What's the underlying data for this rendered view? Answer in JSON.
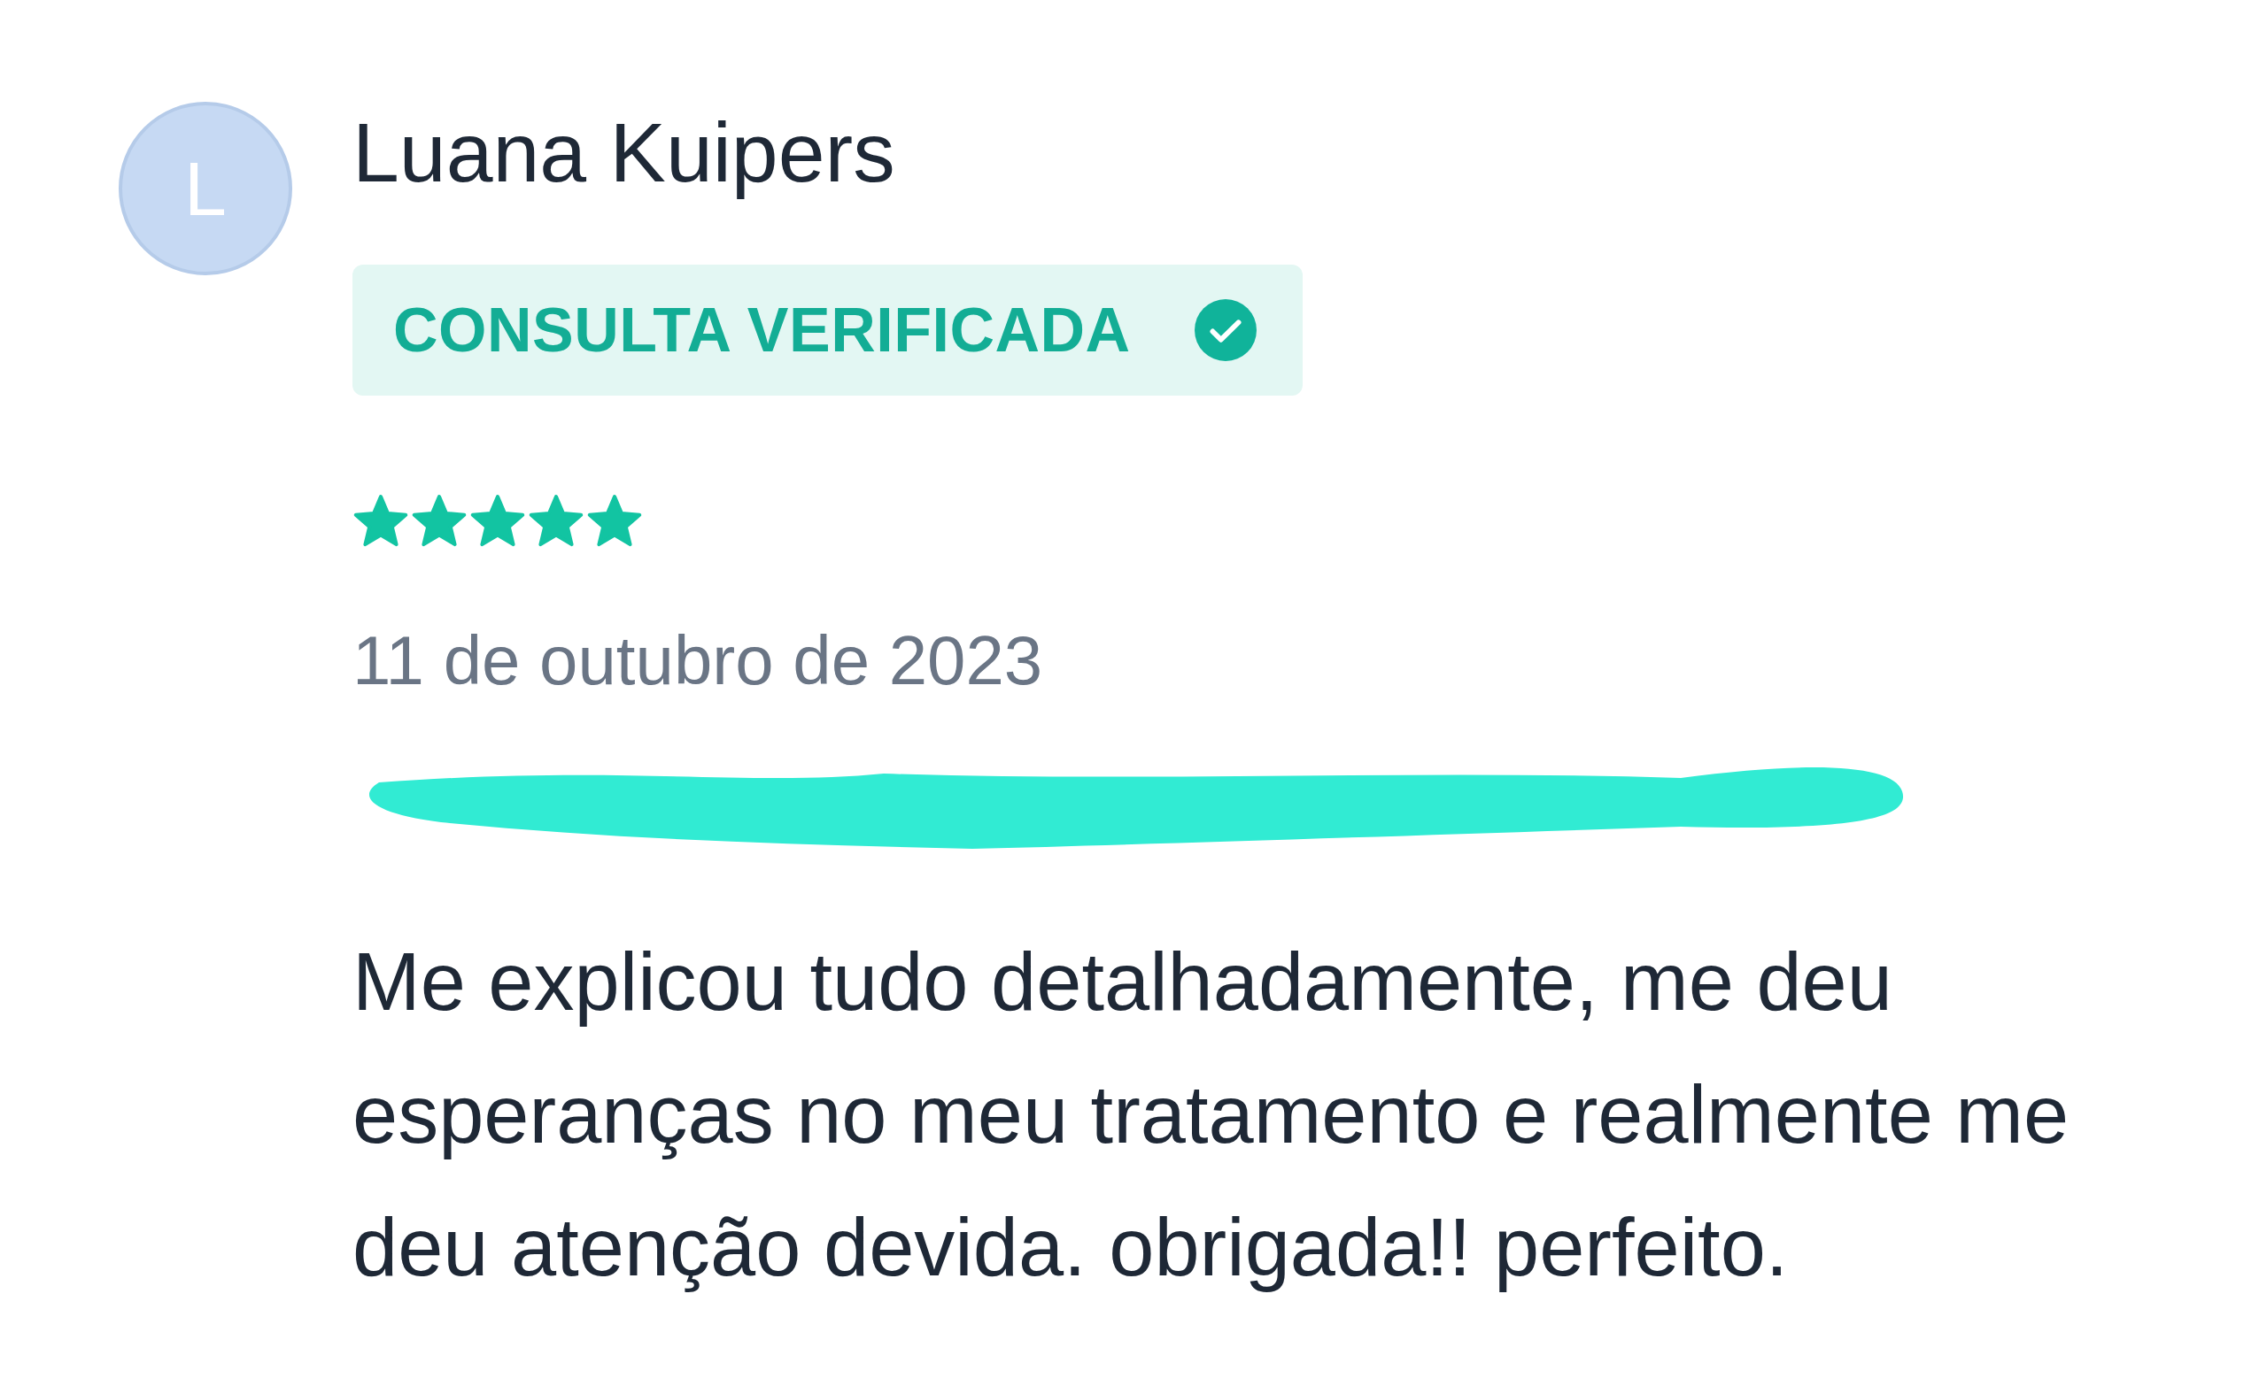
{
  "review": {
    "avatar_letter": "L",
    "author": "Luana Kuipers",
    "badge": {
      "label": "CONSULTA VERIFICADA",
      "verified": true
    },
    "stars": 5,
    "date": "11 de outubro de 2023",
    "redacted": true,
    "text": "Me explicou tudo detalhadamente, me deu esperanças no meu tratamento e realmente me deu atenção devida. obrigada!! perfeito."
  }
}
